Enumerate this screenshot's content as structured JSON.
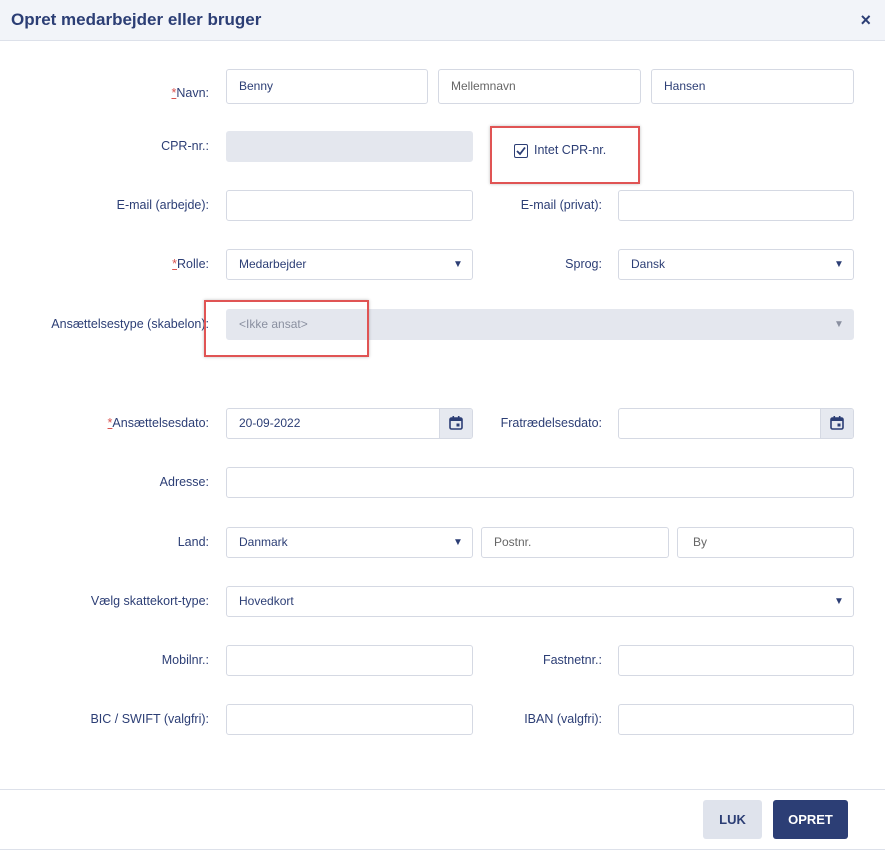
{
  "dialog": {
    "title": "Opret medarbejder eller bruger",
    "close_icon": "×"
  },
  "form": {
    "required_mark": "*",
    "name": {
      "label": "Navn:",
      "first": "Benny",
      "middle_placeholder": "Mellemnavn",
      "last": "Hansen"
    },
    "cpr": {
      "label": "CPR-nr.:",
      "value": "",
      "checkbox_label": "Intet CPR-nr.",
      "checked": true
    },
    "email_work": {
      "label": "E-mail (arbejde):",
      "value": ""
    },
    "email_private": {
      "label": "E-mail (privat):",
      "value": ""
    },
    "role": {
      "label": "Rolle:",
      "value": "Medarbejder"
    },
    "language": {
      "label": "Sprog:",
      "value": "Dansk"
    },
    "employment_type": {
      "label": "Ansættelsestype (skabelon):",
      "value": "<Ikke ansat>"
    },
    "employment_date": {
      "label": "Ansættelsesdato:",
      "value": "20-09-2022"
    },
    "resign_date": {
      "label": "Fratrædelsesdato:",
      "value": ""
    },
    "address": {
      "label": "Adresse:",
      "value": ""
    },
    "country": {
      "label": "Land:",
      "value": "Danmark",
      "postal_placeholder": "Postnr.",
      "city_placeholder": "By"
    },
    "tax_card": {
      "label": "Vælg skattekort-type:",
      "value": "Hovedkort"
    },
    "mobile": {
      "label": "Mobilnr.:",
      "value": ""
    },
    "landline": {
      "label": "Fastnetnr.:",
      "value": ""
    },
    "bic": {
      "label": "BIC / SWIFT (valgfri):",
      "value": ""
    },
    "iban": {
      "label": "IBAN (valgfri):",
      "value": ""
    }
  },
  "buttons": {
    "close": "LUK",
    "create": "OPRET"
  },
  "colors": {
    "primary": "#2c3e75",
    "required": "#d9534f",
    "highlight": "#e05454"
  }
}
